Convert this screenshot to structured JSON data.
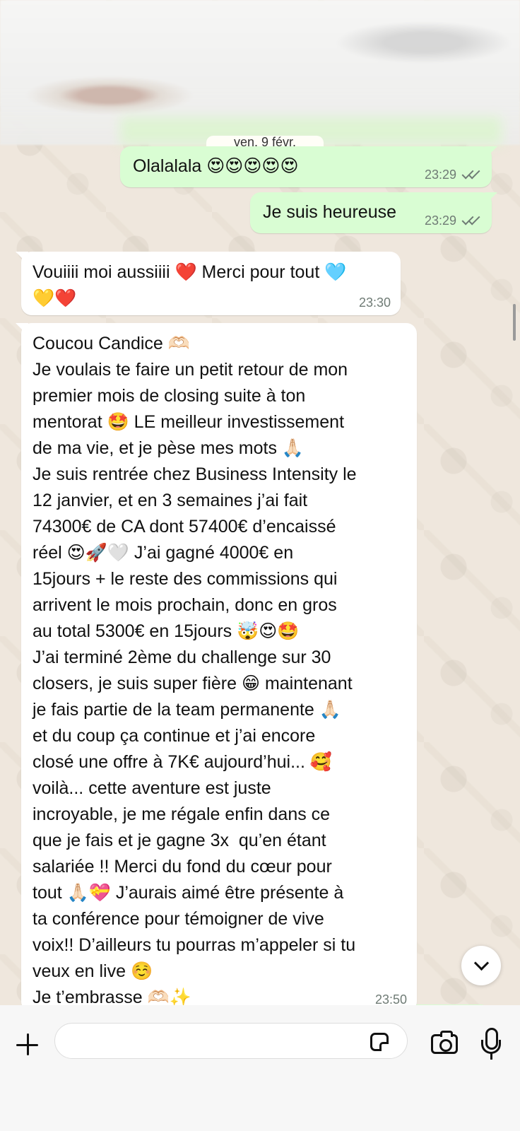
{
  "chat": {
    "date_separator": "ven. 9 févr.",
    "messages": [
      {
        "direction": "outgoing",
        "text": "Olalalala 😍😍😍😍😍",
        "time": "23:29",
        "status": "double-check-icon"
      },
      {
        "direction": "outgoing",
        "text": "Je suis heureuse",
        "time": "23:29",
        "status": "double-check-icon"
      },
      {
        "direction": "incoming",
        "text": "Vouiiii moi aussiiii ❤️ Merci pour tout 🩵\n💛❤️",
        "time": "23:30"
      },
      {
        "direction": "incoming",
        "text": "Coucou Candice 🫶🏻\nJe voulais te faire un petit retour de mon\npremier mois de closing suite à ton\nmentorat 🤩 LE meilleur investissement\nde ma vie, et je pèse mes mots 🙏🏻\nJe suis rentrée chez Business Intensity le\n12 janvier, et en 3 semaines j’ai fait\n74300€ de CA dont 57400€ d’encaissé\nréel 😍🚀🤍 J’ai gagné 4000€ en\n15jours + le reste des commissions qui\narrivent le mois prochain, donc en gros\nau total 5300€ en 15jours 🤯😍🤩\nJ’ai terminé 2ème du challenge sur 30\nclosers, je suis super fière 😁 maintenant\nje fais partie de la team permanente 🙏🏻\net du coup ça continue et j’ai encore\nclosé une offre à 7K€ aujourd’hui... 🥰\nvoilà... cette aventure est juste\nincroyable, je me régale enfin dans ce\nque je fais et je gagne 3x  qu’en étant\nsalariée !! Merci du fond du cœur pour\ntout 🙏🏻💝 J’aurais aimé être présente à\nta conférence pour témoigner de vive\nvoix!! D’ailleurs tu pourras m’appeler si tu\nveux en live ☺️\nJe t’embrasse 🫶🏻✨",
        "time": "23:50"
      }
    ]
  },
  "composer": {
    "input_value": "",
    "plus_icon": "plus-icon",
    "sticker_icon": "sticker-icon",
    "camera_icon": "camera-icon",
    "mic_icon": "microphone-icon"
  },
  "colors": {
    "outgoing_bubble": "#d9fdd3",
    "incoming_bubble": "#ffffff",
    "chat_background": "#efe7dd",
    "meta_text": "#6f7b75"
  }
}
